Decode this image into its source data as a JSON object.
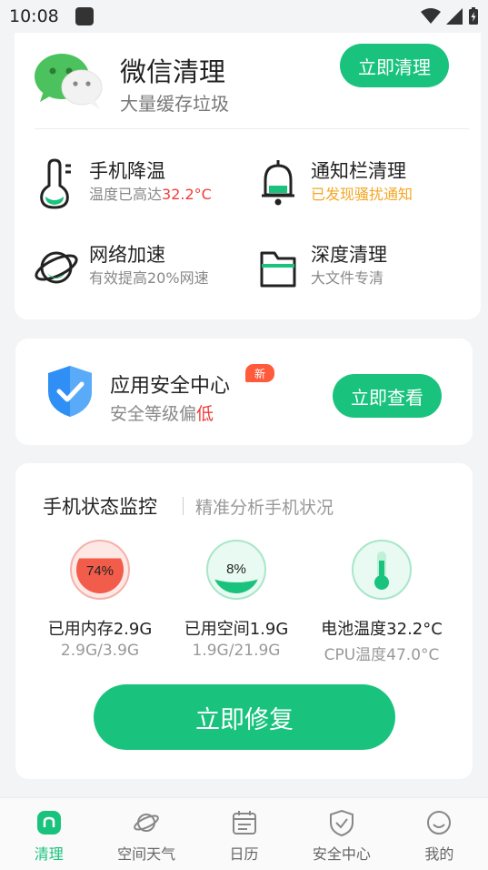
{
  "status_bar": {
    "time": "10:08"
  },
  "wechat_clean": {
    "title": "微信清理",
    "subtitle": "大量缓存垃圾",
    "button": "立即清理"
  },
  "features": [
    {
      "title": "手机降温",
      "sub_prefix": "温度已高达",
      "sub_highlight": "32.2°C",
      "icon": "thermometer-icon"
    },
    {
      "title": "通知栏清理",
      "sub": "已发现骚扰通知",
      "icon": "bell-icon"
    },
    {
      "title": "网络加速",
      "sub": "有效提高20%网速",
      "icon": "planet-icon"
    },
    {
      "title": "深度清理",
      "sub": "大文件专清",
      "icon": "folder-icon"
    }
  ],
  "security": {
    "title": "应用安全中心",
    "badge": "新",
    "sub_prefix": "安全等级偏",
    "sub_highlight": "低",
    "button": "立即查看"
  },
  "monitor": {
    "title": "手机状态监控",
    "subtitle": "精准分析手机状况",
    "gauges": [
      {
        "value_text": "74%",
        "level": 0.74,
        "label": "已用内存2.9G",
        "detail": "2.9G/3.9G",
        "color": "#f25c4a"
      },
      {
        "value_text": "8%",
        "level": 0.08,
        "label": "已用空间1.9G",
        "detail": "1.9G/21.9G",
        "color": "#19c37d"
      },
      {
        "label": "电池温度32.2°C",
        "detail": "CPU温度47.0°C",
        "icon": "thermometer-icon",
        "color": "#19c37d"
      }
    ],
    "button": "立即修复"
  },
  "tabbar": [
    {
      "label": "清理",
      "icon": "home-icon",
      "active": true
    },
    {
      "label": "空间天气",
      "icon": "planet-icon",
      "active": false
    },
    {
      "label": "日历",
      "icon": "calendar-icon",
      "active": false
    },
    {
      "label": "安全中心",
      "icon": "shield-icon",
      "active": false
    },
    {
      "label": "我的",
      "icon": "smile-icon",
      "active": false
    }
  ],
  "colors": {
    "accent": "#19c37d",
    "warning": "#f5a623",
    "danger": "#f23a3a"
  }
}
